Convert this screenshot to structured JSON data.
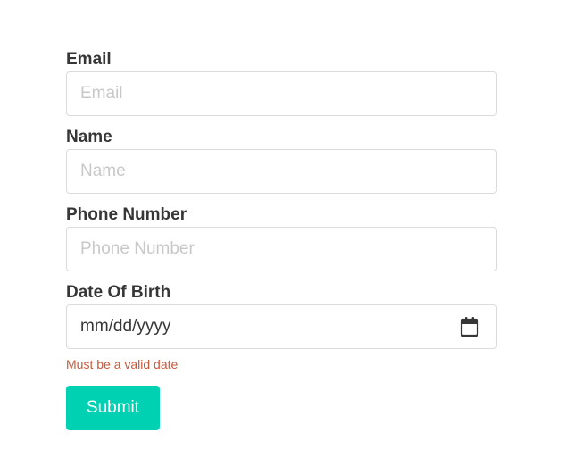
{
  "form": {
    "email": {
      "label": "Email",
      "placeholder": "Email",
      "value": ""
    },
    "name": {
      "label": "Name",
      "placeholder": "Name",
      "value": ""
    },
    "phone": {
      "label": "Phone Number",
      "placeholder": "Phone Number",
      "value": ""
    },
    "dob": {
      "label": "Date Of Birth",
      "display": "mm/dd/yyyy",
      "icon": "calendar-icon",
      "error": "Must be a valid date"
    },
    "submit_label": "Submit"
  },
  "colors": {
    "accent": "#00d1b2",
    "error": "#c8583b",
    "label": "#363636",
    "border": "#dbdbdb",
    "placeholder": "#c8c8c8"
  }
}
